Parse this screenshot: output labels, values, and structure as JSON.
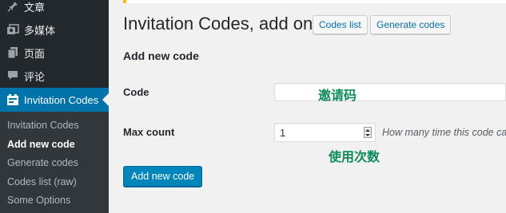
{
  "sidebar": {
    "items": [
      {
        "label": "文章",
        "icon": "pin-icon"
      },
      {
        "label": "多媒体",
        "icon": "media-icon"
      },
      {
        "label": "页面",
        "icon": "page-icon"
      },
      {
        "label": "评论",
        "icon": "comment-icon"
      },
      {
        "label": "Invitation Codes",
        "icon": "plugin-icon",
        "active": true
      }
    ],
    "submenu": [
      {
        "label": "Invitation Codes"
      },
      {
        "label": "Add new code",
        "current": true
      },
      {
        "label": "Generate codes"
      },
      {
        "label": "Codes list (raw)"
      },
      {
        "label": "Some Options"
      }
    ]
  },
  "header": {
    "title": "Invitation Codes, add one!",
    "codes_list_button": "Codes list",
    "generate_codes_button": "Generate codes"
  },
  "form": {
    "section_heading": "Add new code",
    "code_label": "Code",
    "code_value": "",
    "max_count_label": "Max count",
    "max_count_value": "1",
    "max_count_description": "How many time this code can",
    "submit_label": "Add new code"
  },
  "annotations": {
    "code": "邀请码",
    "max_count": "使用次数"
  },
  "colors": {
    "sidebar_bg": "#23282d",
    "submenu_bg": "#32373c",
    "accent": "#0073aa",
    "annotation": "#0e8a58",
    "notice": "#ffb900"
  }
}
